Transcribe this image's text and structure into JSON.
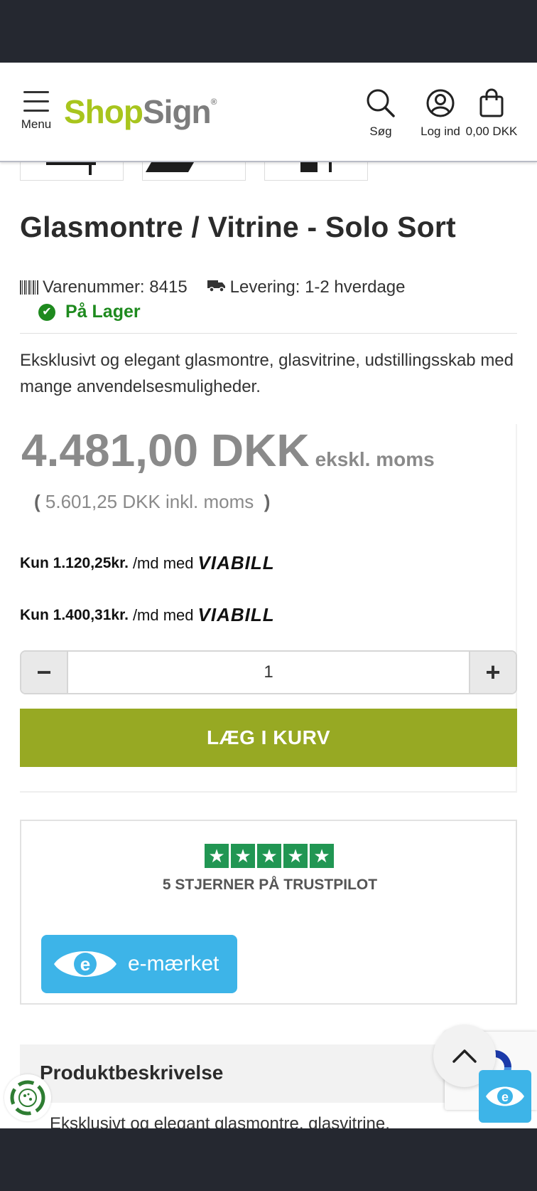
{
  "header": {
    "menu_label": "Menu",
    "logo_shop": "Shop",
    "logo_sign": "Sign",
    "logo_reg": "®",
    "search_label": "Søg",
    "login_label": "Log ind",
    "cart_label": "0,00 DKK"
  },
  "product": {
    "title": "Glasmontre / Vitrine - Solo Sort",
    "sku_text": "Varenummer: 8415",
    "delivery_text": "Levering: 1-2 hverdage",
    "stock_text": "På Lager",
    "description": "Eksklusivt og elegant glasmontre, glasvitrine, udstillingsskab med mange anvendelsesmuligheder."
  },
  "pricing": {
    "price": "4.481,00 DKK",
    "ex_vat_label": "ekskl. moms",
    "incl_open": "(",
    "incl_text": "5.601,25 DKK inkl. moms",
    "incl_close": ")",
    "viabill_1_amount": "Kun 1.120,25kr.",
    "viabill_2_amount": "Kun 1.400,31kr.",
    "viabill_per_month": "/md med",
    "viabill_logo": "VIABILL",
    "quantity": "1",
    "minus_symbol": "−",
    "plus_symbol": "+",
    "add_to_cart": "LÆG I KURV"
  },
  "trust": {
    "rating_stars": 5,
    "star_glyph": "★",
    "trustpilot_text": "5 STJERNER PÅ TRUSTPILOT",
    "emaerket_text": "e-mærket"
  },
  "sections": {
    "product_description_heading": "Produktbeskrivelse",
    "product_description_preview": "Eksklusivt og elegant glasmontre, glasvitrine,"
  },
  "colors": {
    "brand_green": "#a8c51d",
    "button_green": "#97a923",
    "stock_green": "#1e8a1e",
    "trustpilot_green": "#219653",
    "emaerket_blue": "#3db4e8",
    "price_gray": "#8a8a8a"
  }
}
